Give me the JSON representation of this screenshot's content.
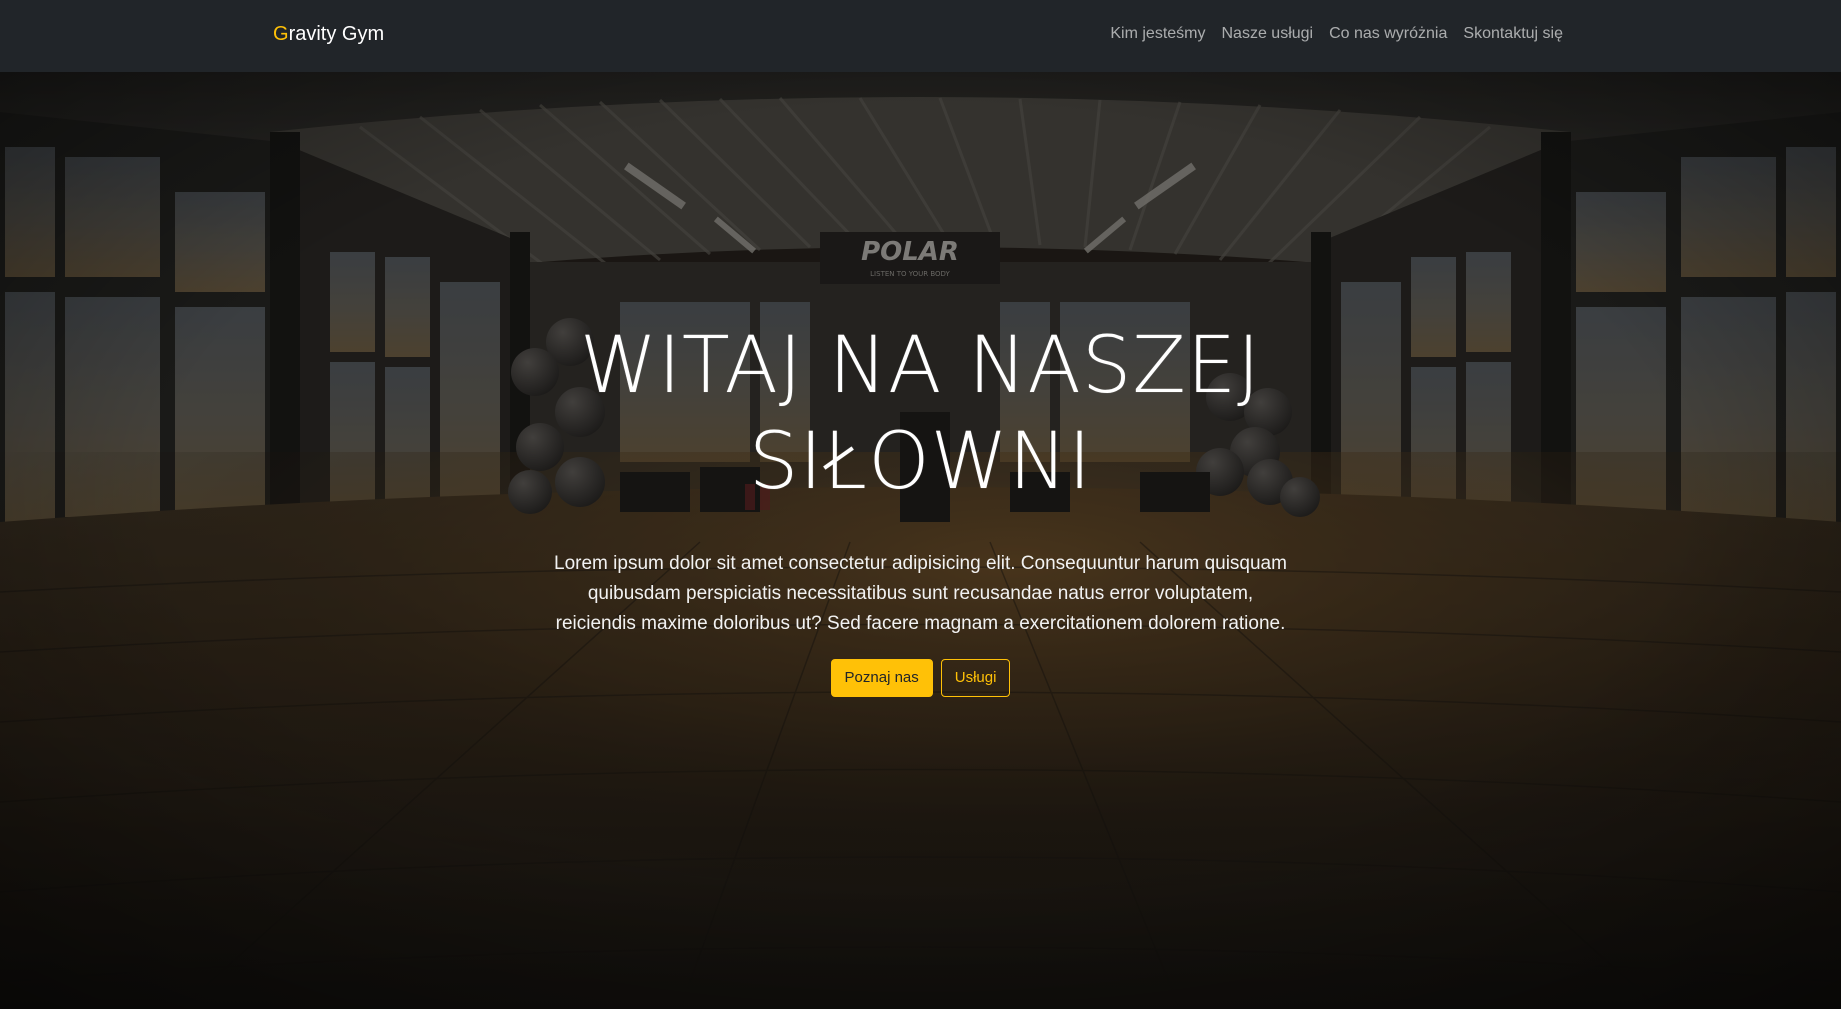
{
  "navbar": {
    "brand_initial": "G",
    "brand_rest": "ravity Gym",
    "links": [
      {
        "label": "Kim jesteśmy"
      },
      {
        "label": "Nasze usługi"
      },
      {
        "label": "Co nas wyróżnia"
      },
      {
        "label": "Skontaktuj się"
      }
    ]
  },
  "hero": {
    "title_line1": "WITAJ NA NASZEJ",
    "title_line2": "SIŁOWNI",
    "text": "Lorem ipsum dolor sit amet consectetur adipisicing elit. Consequuntur harum quisquam quibusdam perspiciatis necessitatibus sunt recusandae natus error voluptatem, reiciendis maxime doloribus ut? Sed facere magnam a exercitationem dolorem ratione.",
    "primary_button": "Poznaj nas",
    "secondary_button": "Usługi",
    "background_sign": "POLAR",
    "background_sign_sub": "LISTEN TO YOUR BODY"
  },
  "colors": {
    "accent": "#ffc107",
    "navbar_bg": "#212529"
  }
}
